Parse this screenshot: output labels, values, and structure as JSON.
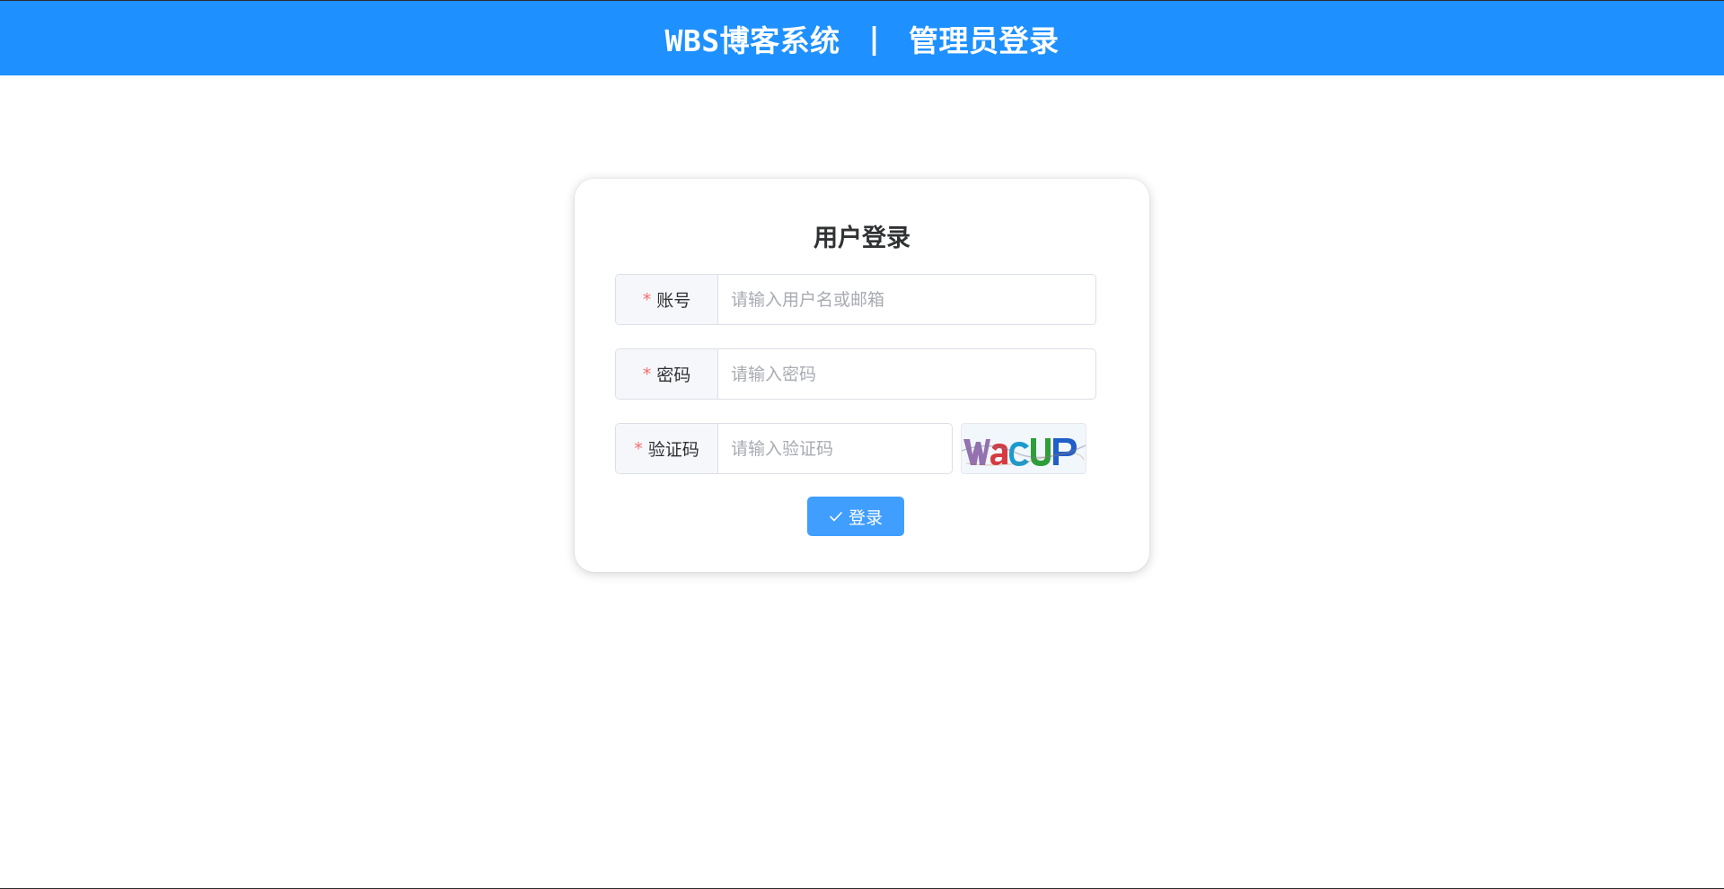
{
  "header": {
    "system_name": "WBS博客系统",
    "separator": "|",
    "page_name": "管理员登录",
    "background_color": "#1e90ff"
  },
  "login_card": {
    "title": "用户登录",
    "fields": {
      "account": {
        "required_mark": "*",
        "label": "账号",
        "value": "",
        "placeholder": "请输入用户名或邮箱"
      },
      "password": {
        "required_mark": "*",
        "label": "密码",
        "value": "",
        "placeholder": "请输入密码"
      },
      "captcha": {
        "required_mark": "*",
        "label": "验证码",
        "value": "",
        "placeholder": "请输入验证码"
      }
    },
    "captcha_image": {
      "text": "WacUP",
      "icon": "captcha-image"
    },
    "login_button": {
      "icon": "check-icon",
      "label": "登录",
      "color": "#409eff"
    }
  }
}
